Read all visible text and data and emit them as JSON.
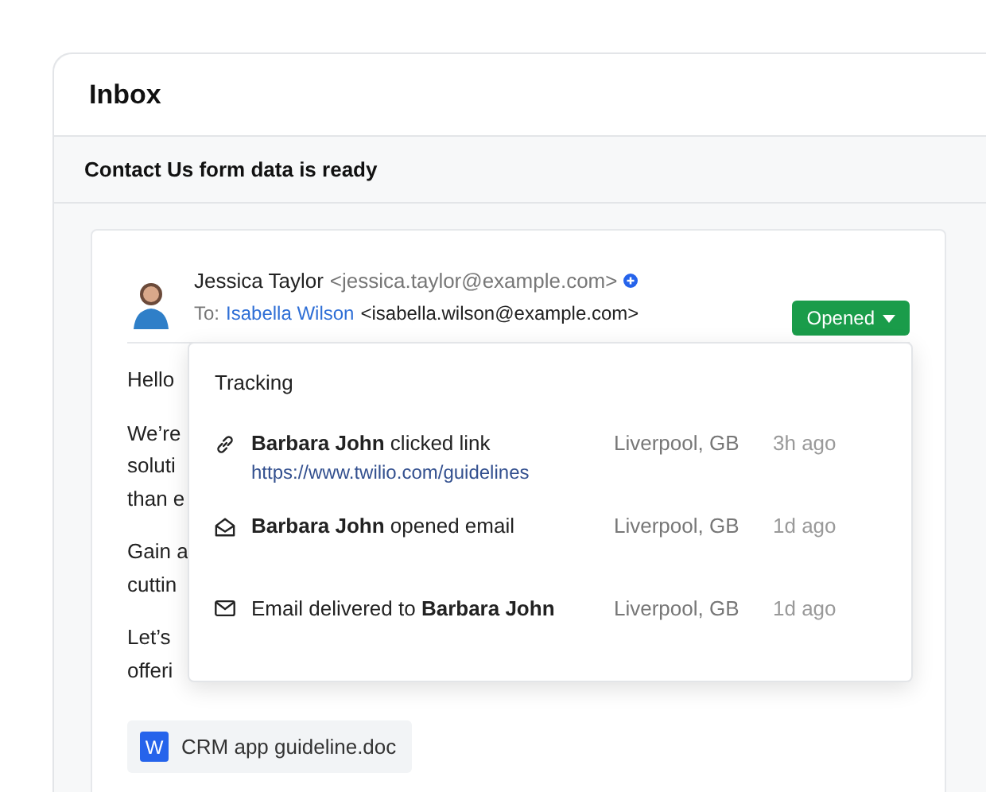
{
  "header": {
    "title": "Inbox"
  },
  "subject": "Contact Us form data is ready",
  "email": {
    "sender_name": "Jessica Taylor",
    "sender_address": "<jessica.taylor@example.com>",
    "to_label": "To:",
    "recipient_name": "Isabella Wilson",
    "recipient_address": "<isabella.wilson@example.com>",
    "status_button": "Opened",
    "body": [
      [
        "Hello"
      ],
      [
        "We’re",
        "soluti",
        "than e"
      ],
      [
        "Gain a",
        "cuttin"
      ],
      [
        "Let’s",
        "offeri"
      ]
    ],
    "attachment": {
      "name": "CRM app guideline.doc",
      "icon_letter": "W"
    }
  },
  "tracking": {
    "title": "Tracking",
    "events": [
      {
        "kind": "link",
        "text": "**Barbara John** clicked link",
        "url": "https://www.twilio.com/guidelines",
        "location": "Liverpool, GB",
        "time": "3h ago"
      },
      {
        "kind": "opened",
        "text": "**Barbara John** opened email",
        "location": "Liverpool, GB",
        "time": "1d ago"
      },
      {
        "kind": "delivered",
        "text": "Email delivered to **Barbara John**",
        "location": "Liverpool, GB",
        "time": "1d ago"
      }
    ]
  }
}
